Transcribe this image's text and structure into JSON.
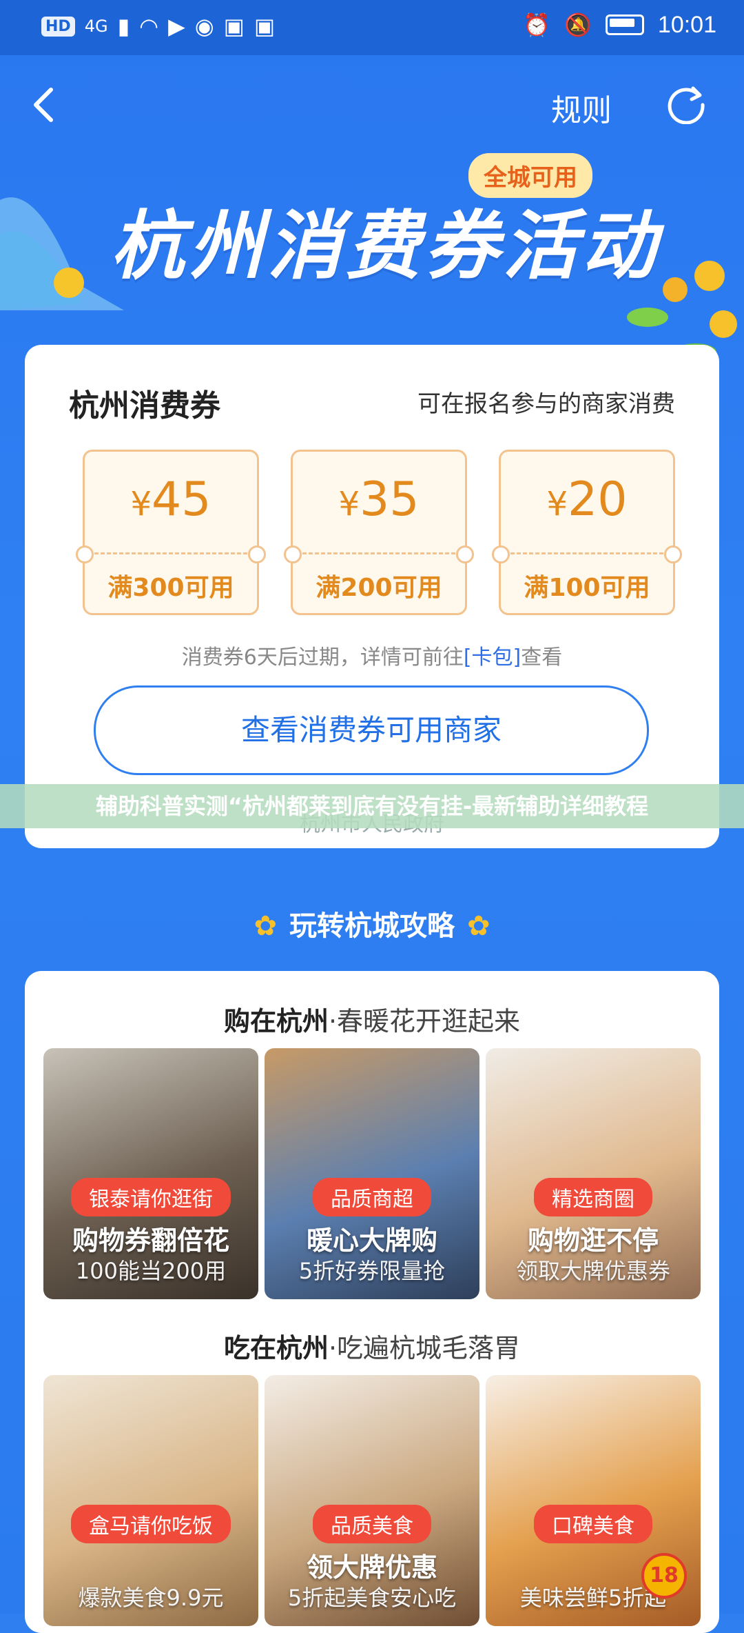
{
  "status_bar": {
    "hd": "HD",
    "signal": "4G",
    "time": "10:01"
  },
  "header": {
    "back_icon": "chevron-left-icon",
    "rules_label": "规则",
    "refresh_icon": "refresh-icon"
  },
  "hero": {
    "title": "杭州消费券活动",
    "badge": "全城可用"
  },
  "coupon_card": {
    "title": "杭州消费券",
    "subtitle": "可在报名参与的商家消费",
    "coupons": [
      {
        "amount": "45",
        "condition": "满300可用"
      },
      {
        "amount": "35",
        "condition": "满200可用"
      },
      {
        "amount": "20",
        "condition": "满100可用"
      }
    ],
    "currency": "¥",
    "expire_prefix": "消费券6天后过期，详情可前往",
    "expire_link": "[卡包]",
    "expire_suffix": "查看",
    "button": "查看消费券可用商家",
    "footer": "杭州市人民政府"
  },
  "overlay_banner": "辅助科普实测“杭州都莱到底有没有挂-最新辅助详细教程",
  "guide": {
    "title": "玩转杭城攻略",
    "shop": {
      "heading_bold": "购在杭州",
      "heading_rest": "·春暖花开逛起来",
      "tiles": [
        {
          "tag": "银泰请你逛街",
          "title": "购物券翻倍花",
          "sub": "100能当200用"
        },
        {
          "tag": "品质商超",
          "title": "暖心大牌购",
          "sub": "5折好券限量抢"
        },
        {
          "tag": "精选商圈",
          "title": "购物逛不停",
          "sub": "领取大牌优惠券"
        }
      ]
    },
    "eat": {
      "heading_bold": "吃在杭州",
      "heading_rest": "·吃遍杭城毛落胃",
      "tiles": [
        {
          "tag": "盒马请你吃饭",
          "title": "",
          "sub": "爆款美食9.9元"
        },
        {
          "tag": "品质美食",
          "title": "领大牌优惠",
          "sub": "5折起美食安心吃"
        },
        {
          "tag": "口碑美食",
          "title": "",
          "sub": "美味尝鲜5折起"
        }
      ],
      "badge": "18"
    }
  }
}
